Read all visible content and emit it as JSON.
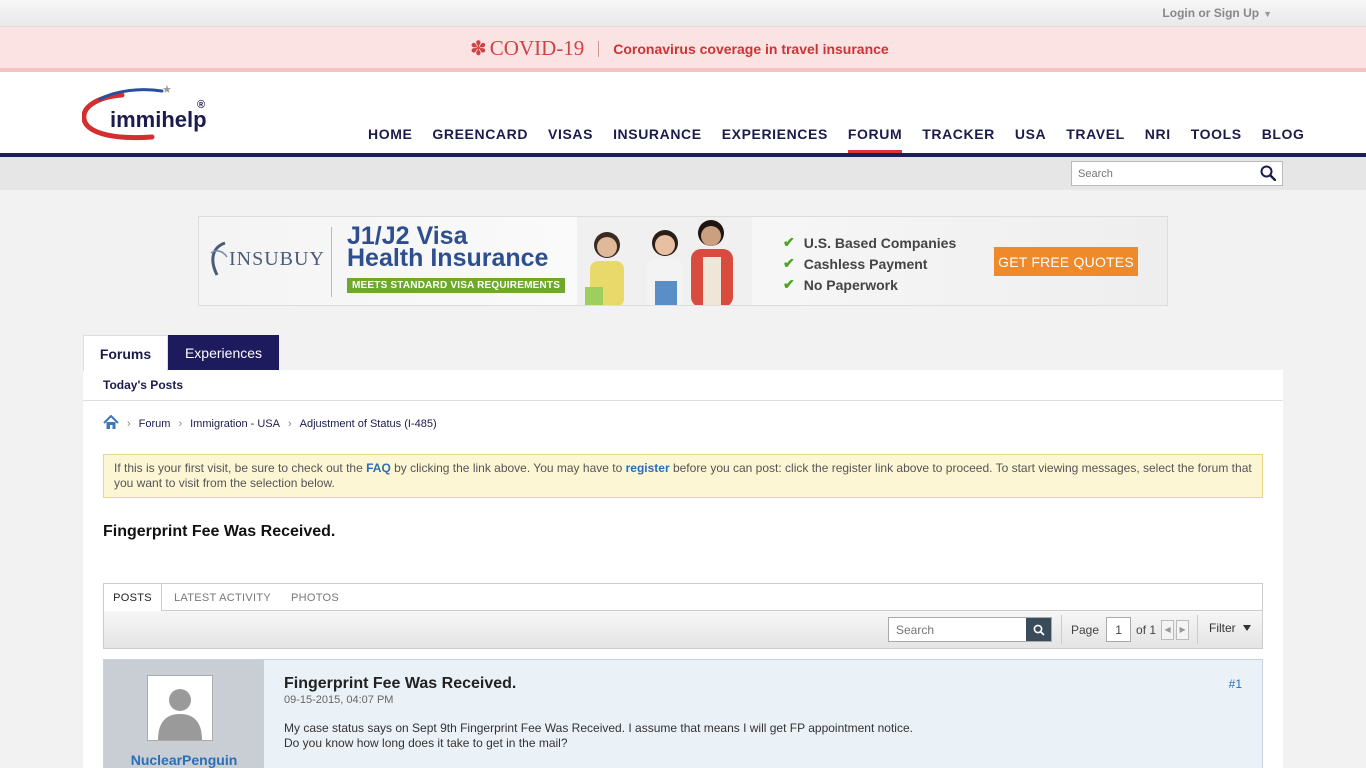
{
  "topbar": {
    "login": "Login or Sign Up"
  },
  "covid": {
    "logo": "COVID-19",
    "link": "Coronavirus coverage in travel insurance"
  },
  "logo": {
    "text": "immihelp"
  },
  "nav": [
    "HOME",
    "GREENCARD",
    "VISAS",
    "INSURANCE",
    "EXPERIENCES",
    "FORUM",
    "TRACKER",
    "USA",
    "TRAVEL",
    "NRI",
    "TOOLS",
    "BLOG"
  ],
  "nav_active": "FORUM",
  "header_search": {
    "placeholder": "Search"
  },
  "banner": {
    "brand": "INSUBUY",
    "title_line1": "J1/J2 Visa",
    "title_line2": "Health Insurance",
    "tag": "MEETS STANDARD VISA REQUIREMENTS",
    "checks": [
      "U.S. Based Companies",
      "Cashless Payment",
      "No Paperwork"
    ],
    "cta": "GET FREE QUOTES",
    "colors": {
      "accent": "#f0892a",
      "check": "#4ea323",
      "title": "#2e4f8f"
    }
  },
  "tabs": {
    "forums": "Forums",
    "experiences": "Experiences"
  },
  "subnav": {
    "todays_posts": "Today's Posts"
  },
  "breadcrumb": [
    "Forum",
    "Immigration - USA",
    "Adjustment of Status (I-485)"
  ],
  "notice": {
    "part1": "If this is your first visit, be sure to check out the ",
    "faq": "FAQ",
    "part2": " by clicking the link above. You may have to ",
    "register": "register",
    "part3": " before you can post: click the register link above to proceed. To start viewing messages, select the forum that you want to visit from the selection below."
  },
  "thread": {
    "title": "Fingerprint Fee Was Received."
  },
  "widget": {
    "tabs": [
      "POSTS",
      "LATEST ACTIVITY",
      "PHOTOS"
    ],
    "search_placeholder": "Search",
    "page_label": "Page",
    "page_value": "1",
    "of_label": "of 1",
    "filter": "Filter"
  },
  "post": {
    "username": "NuclearPenguin",
    "title": "Fingerprint Fee Was Received.",
    "date": "09-15-2015, 04:07 PM",
    "number": "#1",
    "body_line1": "My case status says on Sept 9th Fingerprint Fee Was Received. I assume that means I will get FP appointment notice.",
    "body_line2": "Do you know how long does it take to get in the mail?"
  }
}
